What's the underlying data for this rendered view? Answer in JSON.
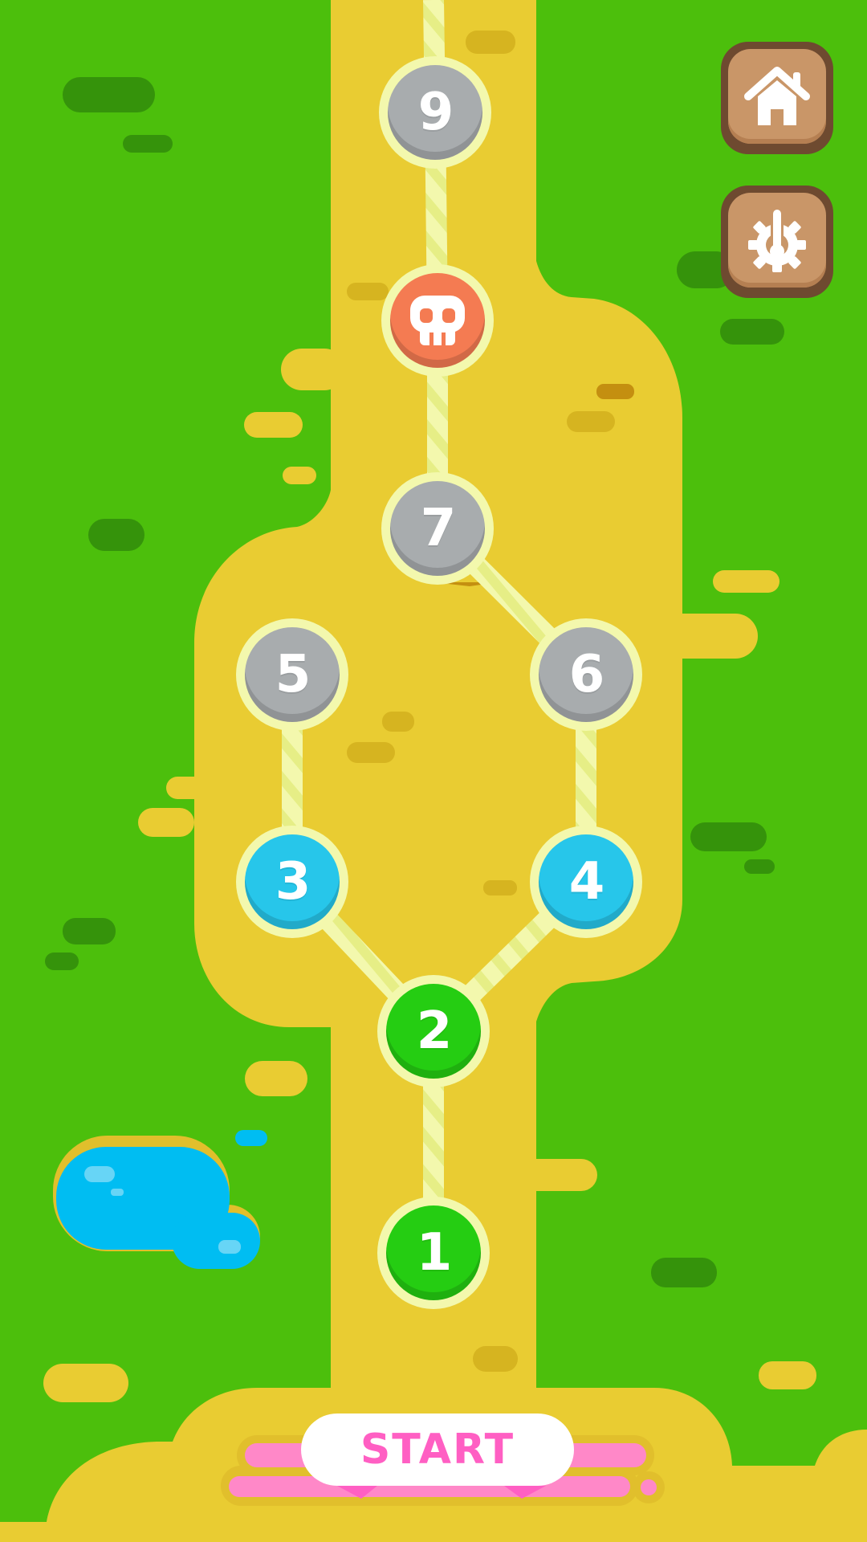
{
  "levels": [
    {
      "label": "1",
      "state": "completed"
    },
    {
      "label": "2",
      "state": "completed"
    },
    {
      "label": "3",
      "state": "unlocked"
    },
    {
      "label": "4",
      "state": "unlocked"
    },
    {
      "label": "5",
      "state": "locked"
    },
    {
      "label": "6",
      "state": "locked"
    },
    {
      "label": "7",
      "state": "locked"
    },
    {
      "label": "skull",
      "state": "boss"
    },
    {
      "label": "9",
      "state": "locked"
    }
  ],
  "buttons": {
    "home_icon": "home-icon",
    "settings_icon": "settings-thermometer-icon",
    "start_label": "START"
  },
  "colors": {
    "grass": "#4cbf0c",
    "path": "#e9cc32",
    "completed": "#25cd12",
    "unlocked": "#27c6ea",
    "locked": "#a8acae",
    "boss": "#f47b52",
    "start_text": "#ff5fc3"
  }
}
